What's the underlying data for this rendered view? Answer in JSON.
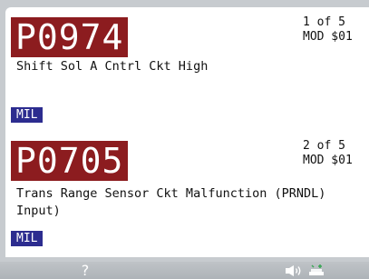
{
  "dtc_list": [
    {
      "code": "P0974",
      "count": "1 of 5",
      "module": "MOD $01",
      "description": "Shift Sol A Cntrl Ckt High",
      "badge": "MIL"
    },
    {
      "code": "P0705",
      "count": "2 of 5",
      "module": "MOD $01",
      "description": "Trans Range Sensor Ckt Malfunction (PRNDL) Input)",
      "badge": "MIL"
    }
  ],
  "footer": {
    "help_label": "?",
    "speaker_icon": "speaker-icon",
    "power_icon": "power-status-icon"
  },
  "colors": {
    "code_background": "#8c1c1f",
    "mil_background": "#2c2c8f",
    "power_green": "#3aa655"
  }
}
